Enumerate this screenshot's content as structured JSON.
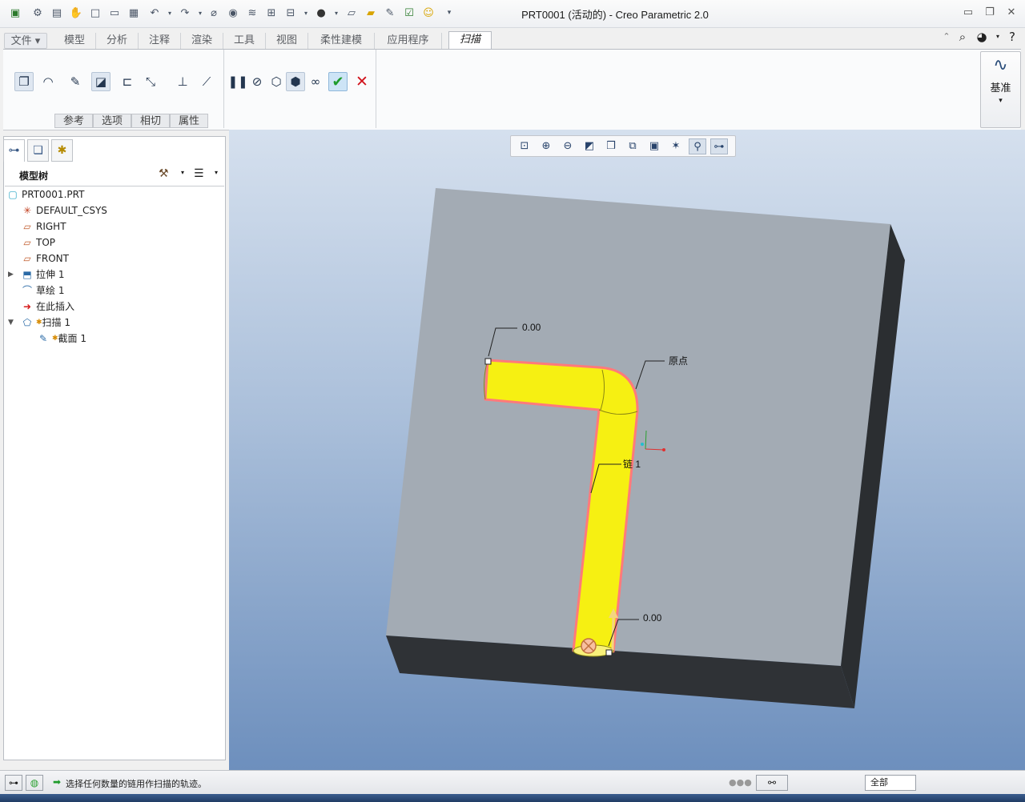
{
  "app": {
    "title": "PRT0001 (活动的) - Creo Parametric 2.0"
  },
  "ribbon_tabs": [
    {
      "label": "文件 ▾"
    },
    {
      "label": "模型"
    },
    {
      "label": "分析"
    },
    {
      "label": "注释"
    },
    {
      "label": "渲染"
    },
    {
      "label": "工具"
    },
    {
      "label": "视图"
    },
    {
      "label": "柔性建模"
    },
    {
      "label": "应用程序"
    },
    {
      "label": "扫描"
    }
  ],
  "ribbon": {
    "slideup_tabs": [
      "参考",
      "选项",
      "相切",
      "属性"
    ],
    "datum_label": "基准"
  },
  "model_tree": {
    "header": "模型树",
    "items": [
      {
        "label": "PRT0001.PRT",
        "icon": "part-icon"
      },
      {
        "label": "DEFAULT_CSYS",
        "icon": "csys-icon"
      },
      {
        "label": "RIGHT",
        "icon": "datum-plane-icon"
      },
      {
        "label": "TOP",
        "icon": "datum-plane-icon"
      },
      {
        "label": "FRONT",
        "icon": "datum-plane-icon"
      },
      {
        "label": "拉伸 1",
        "icon": "extrude-icon"
      },
      {
        "label": "草绘 1",
        "icon": "sketch-icon"
      },
      {
        "label": "在此插入",
        "icon": "insert-here-arrow-icon"
      },
      {
        "label": "扫描 1",
        "icon": "sweep-icon"
      },
      {
        "label": "截面 1",
        "icon": "section-sketch-icon"
      }
    ]
  },
  "viewport": {
    "dim_top": "0.00",
    "dim_bottom": "0.00",
    "origin_label": "原点",
    "chain_label": "链 1"
  },
  "statusbar": {
    "message": "选择任何数量的链用作扫描的轨迹。",
    "filter_value": "全部"
  },
  "colors": {
    "sweep": "#f6f012",
    "trajectory": "#ff7a7a",
    "block_top": "#a3abb4",
    "block_side": "#2b2e31"
  }
}
